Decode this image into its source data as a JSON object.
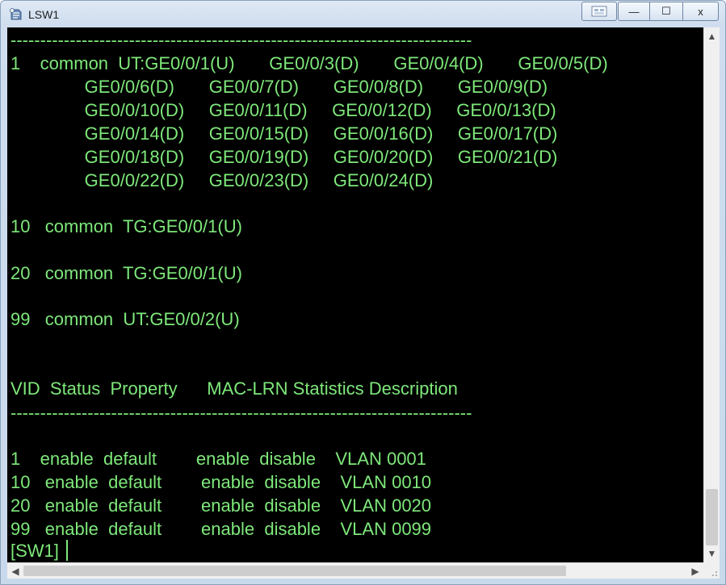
{
  "window": {
    "title": "LSW1",
    "controls": {
      "minimize": "—",
      "maximize": "☐",
      "close": "x"
    }
  },
  "terminal": {
    "lines": [
      "------------------------------------------------------------------------------",
      "1    common  UT:GE0/0/1(U)       GE0/0/3(D)       GE0/0/4(D)       GE0/0/5(D)",
      "               GE0/0/6(D)       GE0/0/7(D)       GE0/0/8(D)       GE0/0/9(D)",
      "               GE0/0/10(D)     GE0/0/11(D)     GE0/0/12(D)     GE0/0/13(D)",
      "               GE0/0/14(D)     GE0/0/15(D)     GE0/0/16(D)     GE0/0/17(D)",
      "               GE0/0/18(D)     GE0/0/19(D)     GE0/0/20(D)     GE0/0/21(D)",
      "               GE0/0/22(D)     GE0/0/23(D)     GE0/0/24(D)",
      "",
      "10   common  TG:GE0/0/1(U)",
      "",
      "20   common  TG:GE0/0/1(U)",
      "",
      "99   common  UT:GE0/0/2(U)",
      "",
      "",
      "VID  Status  Property      MAC-LRN Statistics Description",
      "------------------------------------------------------------------------------",
      "",
      "1    enable  default        enable  disable    VLAN 0001",
      "10   enable  default        enable  disable    VLAN 0010",
      "20   enable  default        enable  disable    VLAN 0020",
      "99   enable  default        enable  disable    VLAN 0099",
      "[SW1]"
    ],
    "text_color": "#7ee87a",
    "background": "#000000"
  },
  "scrollbars": {
    "up_arrow": "▲",
    "down_arrow": "▼",
    "left_arrow": "◀",
    "right_arrow": "▶"
  }
}
